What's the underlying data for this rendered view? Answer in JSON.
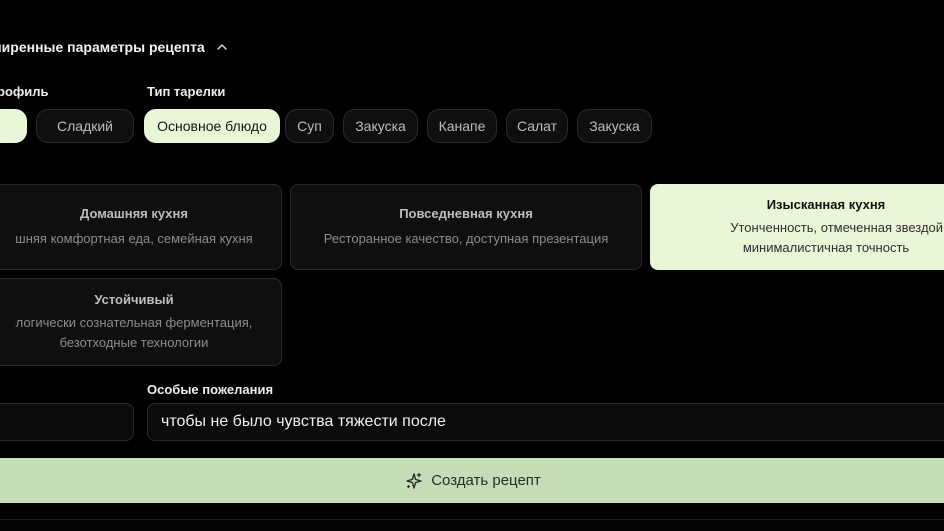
{
  "section": {
    "title": "ширенные параметры рецепта"
  },
  "flavor": {
    "label": "рофиль",
    "chips": [
      "",
      "Сладкий"
    ],
    "selected": 0
  },
  "plate": {
    "label": "Тип тарелки",
    "chips": [
      "Основное блюдо",
      "Суп",
      "Закуска",
      "Канапе",
      "Салат",
      "Закуска"
    ],
    "selected": 0
  },
  "styles": [
    {
      "title": "Домашняя кухня",
      "desc": [
        "шняя комфортная еда, семейная кухня"
      ]
    },
    {
      "title": "Повседневная кухня",
      "desc": [
        "Ресторанное качество, доступная презентация"
      ]
    },
    {
      "title": "Изысканная кухня",
      "desc": [
        "Утонченность, отмеченная звездой Мишл",
        "минималистичная точность"
      ]
    },
    {
      "title": "Устойчивый",
      "desc": [
        "логически сознательная ферментация,",
        "безотходные технологии"
      ]
    }
  ],
  "selected_style": 2,
  "requests": {
    "label": "Особые пожелания",
    "value": "чтобы не было чувства тяжести после"
  },
  "left_input": {
    "value": ""
  },
  "actions": {
    "create_label": "Создать рецепт"
  },
  "colors": {
    "accent": "#e8f8d6",
    "button": "#c6dcb6",
    "background": "#000000"
  },
  "icons": {
    "section_toggle": "chevron-up-icon",
    "create": "sparkles-icon"
  }
}
